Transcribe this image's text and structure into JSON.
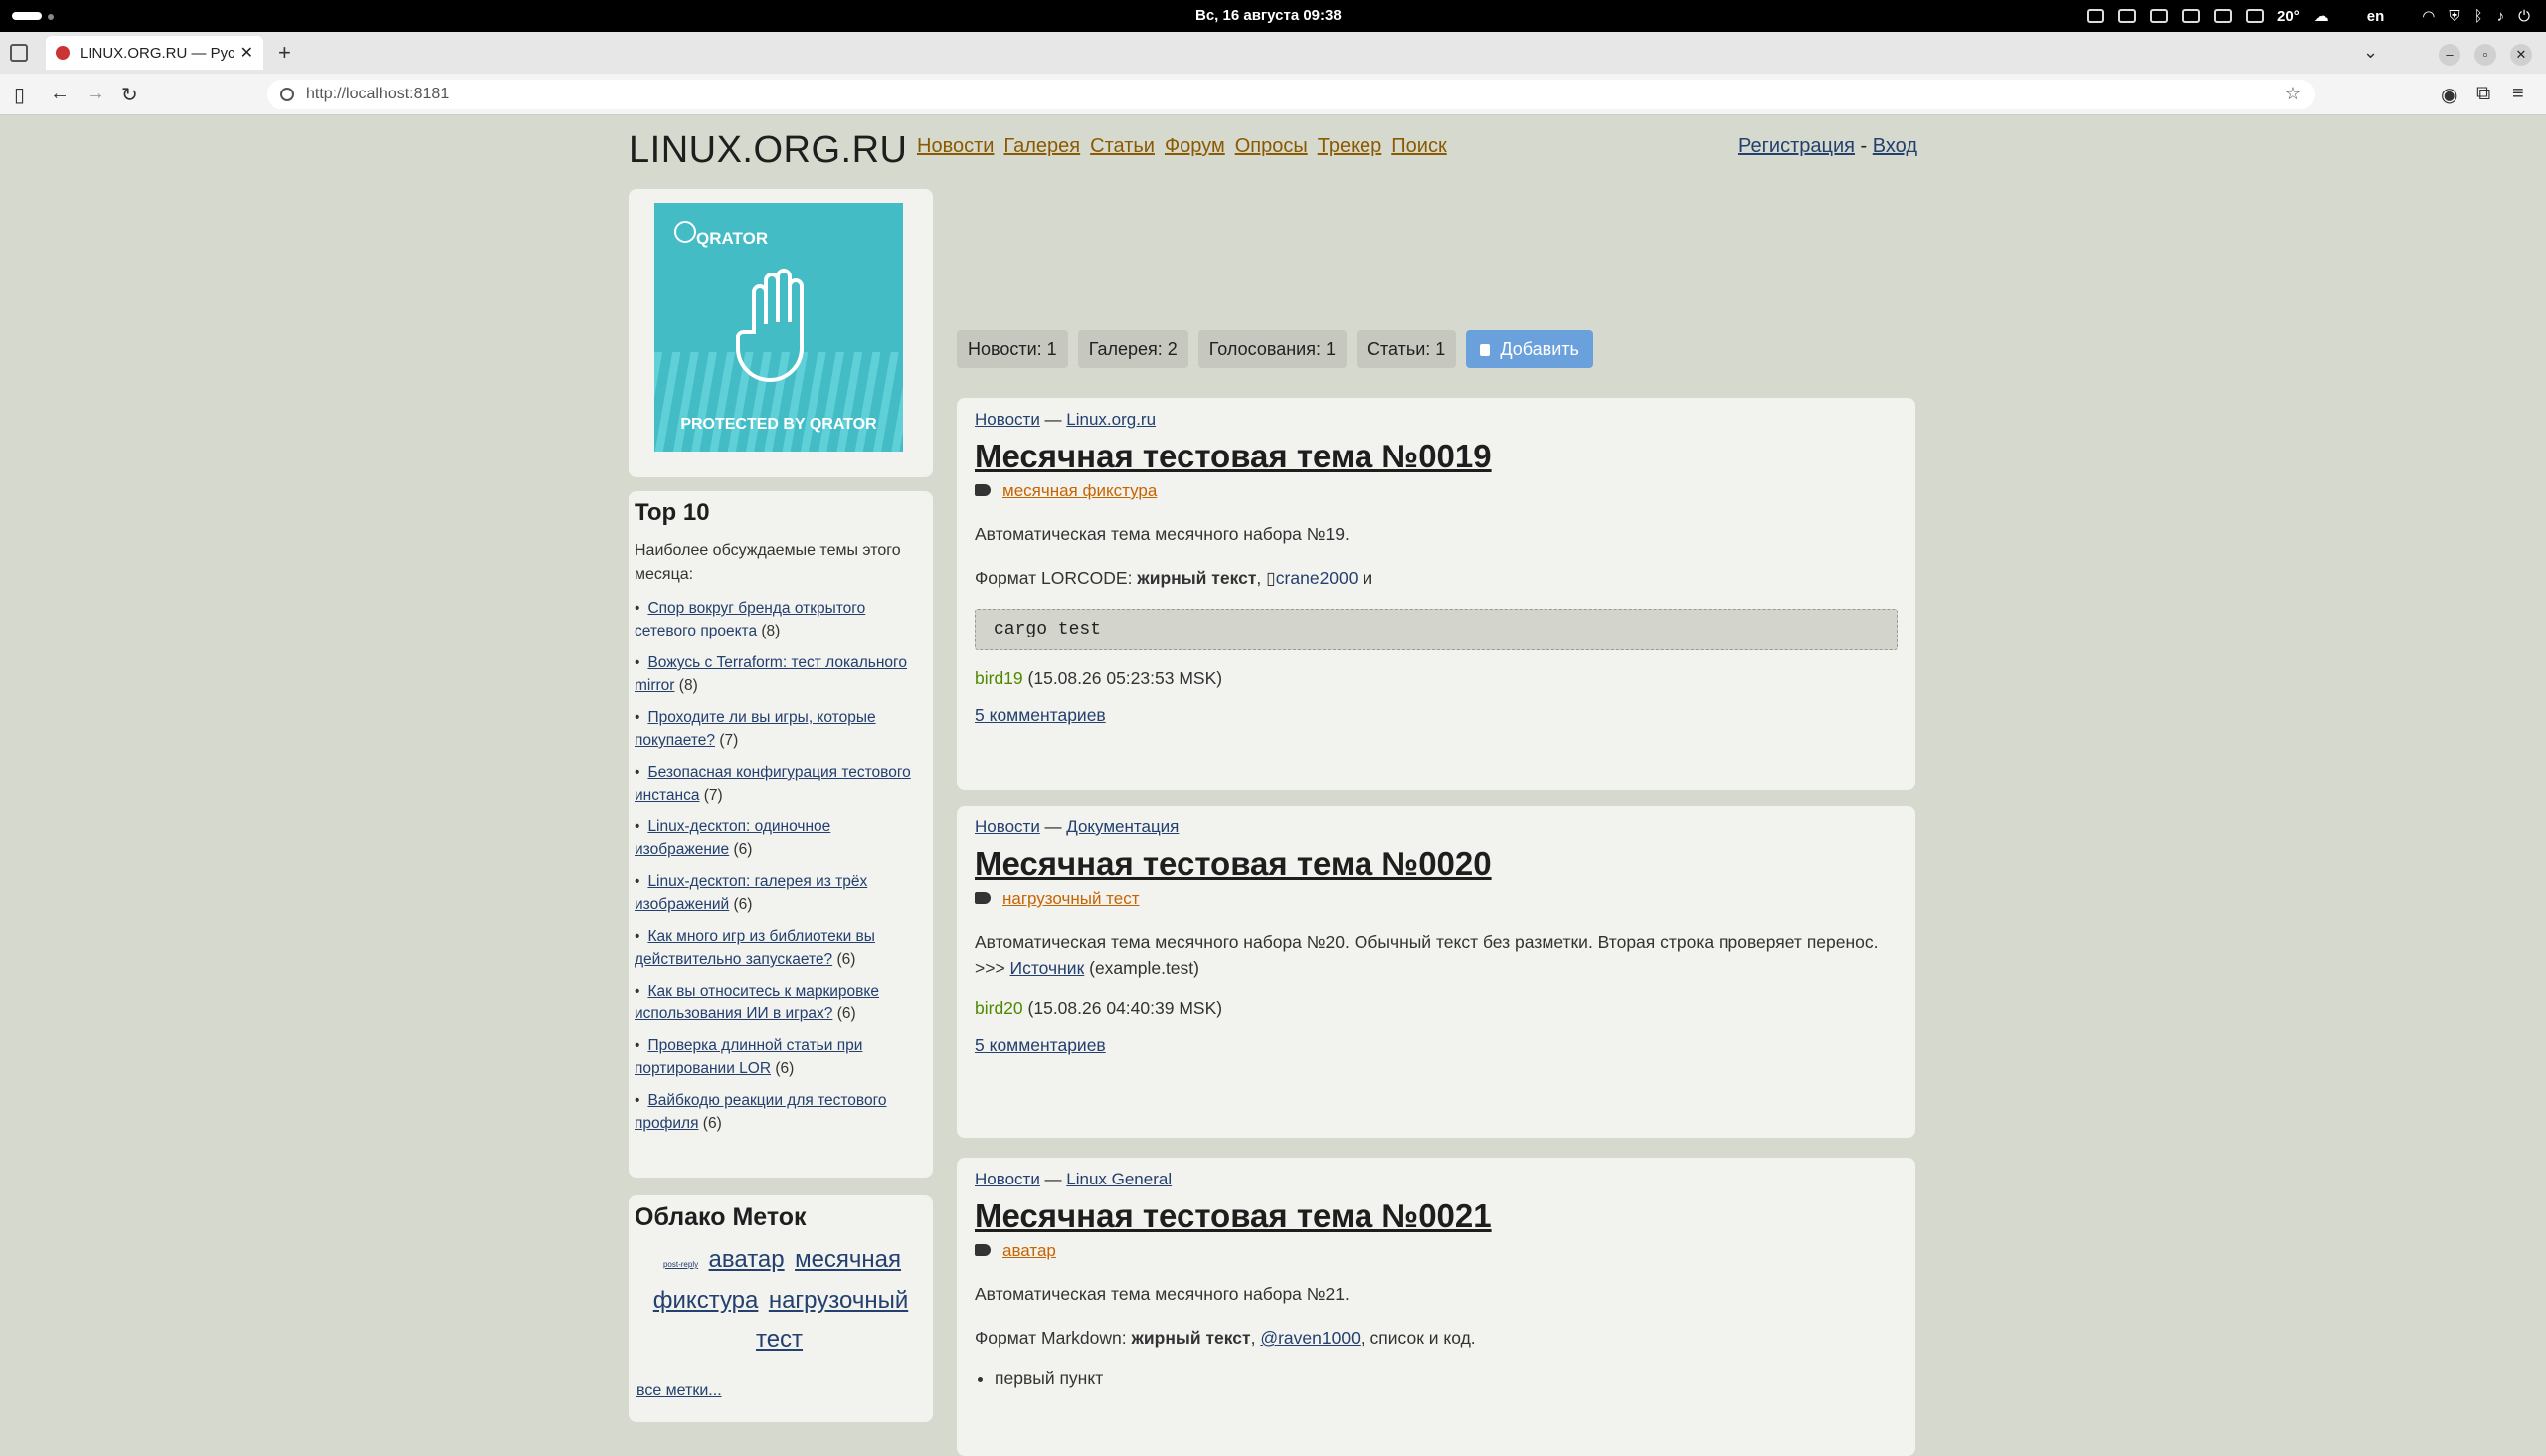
{
  "system": {
    "clock": "Вс, 16 августа  09:38",
    "temp": "20°",
    "lang": "en"
  },
  "browser": {
    "tab_title": "LINUX.ORG.RU — Русс",
    "url": "http://localhost:8181"
  },
  "site": {
    "logo": "LINUX.ORG.RU",
    "nav": [
      "Новости",
      "Галерея",
      "Статьи",
      "Форум",
      "Опросы",
      "Трекер",
      "Поиск"
    ],
    "register": "Регистрация",
    "sep": " - ",
    "login": "Вход",
    "ad": {
      "brand": "QRATOR",
      "protected": "PROTECTED BY QRATOR"
    },
    "top10": {
      "title": "Top 10",
      "subtitle": "Наиболее обсуждаемые темы этого месяца:",
      "items": [
        {
          "title": "Спор вокруг бренда открытого сетевого проекта",
          "count": "(8)"
        },
        {
          "title": "Вожусь с Terraform: тест локального mirror",
          "count": "(8)"
        },
        {
          "title": "Проходите ли вы игры, которые покупаете?",
          "count": "(7)"
        },
        {
          "title": "Безопасная конфигурация тестового инстанса",
          "count": "(7)"
        },
        {
          "title": "Linux-десктоп: одиночное изображение",
          "count": "(6)"
        },
        {
          "title": "Linux-десктоп: галерея из трёх изображений",
          "count": "(6)"
        },
        {
          "title": "Как много игр из библиотеки вы действительно запускаете?",
          "count": "(6)"
        },
        {
          "title": "Как вы относитесь к маркировке использования ИИ в играх?",
          "count": "(6)"
        },
        {
          "title": "Проверка длинной статьи при портировании LOR",
          "count": "(6)"
        },
        {
          "title": "Вайбкодю реакции для тестового профиля",
          "count": "(6)"
        }
      ]
    },
    "tags": {
      "title": "Облако Меток",
      "small": "post-reply",
      "items": [
        "аватар",
        "месячная фикстура",
        "нагрузочный тест"
      ],
      "all": "все метки..."
    },
    "tabs": [
      "Новости: 1",
      "Галерея: 2",
      "Голосования: 1",
      "Статьи: 1"
    ],
    "add": "Добавить",
    "news": [
      {
        "section": "Новости",
        "dash": " — ",
        "group": "Linux.org.ru",
        "title": "Месячная тестовая тема №0019",
        "tag": "месячная фикстура",
        "p1": "Автоматическая тема месячного набора №19.",
        "fmt": "Формат LORCODE: ",
        "bold": "жирный текст",
        "comma": ", ",
        "user_mention": "crane2000",
        "and": " и",
        "code": "cargo test",
        "author": "bird19",
        "date": "(15.08.26 05:23:53 MSK)",
        "comments": "5 комментариев"
      },
      {
        "section": "Новости",
        "dash": " — ",
        "group": "Документация",
        "title": "Месячная тестовая тема №0020",
        "tag": "нагрузочный тест",
        "p1": "Автоматическая тема месячного набора №20. Обычный текст без разметки. Вторая строка проверяет перенос.",
        "src_prefix": ">>> ",
        "src": "Источник",
        "src_host": " (example.test)",
        "author": "bird20",
        "date": "(15.08.26 04:40:39 MSK)",
        "comments": "5 комментариев"
      },
      {
        "section": "Новости",
        "dash": " — ",
        "group": "Linux General",
        "title": "Месячная тестовая тема №0021",
        "tag": "аватар",
        "p1": "Автоматическая тема месячного набора №21.",
        "fmt": "Формат Markdown: ",
        "bold": "жирный текст",
        "comma": ", ",
        "user_mention": "@raven1000",
        "rest": ", список и код.",
        "li1": "первый пункт"
      }
    ]
  },
  "colors": {
    "bg": "#d6d9ce",
    "link": "#23406e",
    "nav": "#8b5a00",
    "tag": "#c86400",
    "author": "#4e8a00",
    "add": "#6aa1dc"
  }
}
